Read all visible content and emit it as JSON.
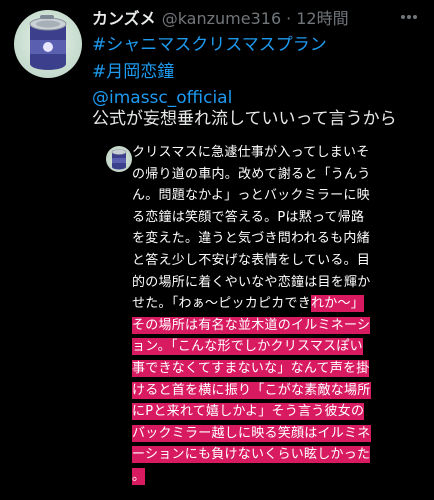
{
  "tweet": {
    "display_name": "カンズメ",
    "handle": "@kanzume316",
    "separator": "·",
    "timestamp": "12時間",
    "hashtags": [
      "#シャニマスクリスマスプラン",
      "#月岡恋鐘"
    ],
    "mention": "@imassc_official",
    "text": "公式が妄想垂れ流していいって言うから"
  },
  "memo": {
    "lines": [
      {
        "plain": "クリスマスに急遽仕事が入ってしまいそ",
        "highlight": ""
      },
      {
        "plain": "の帰り道の車内。改めて謝ると「うんう",
        "highlight": ""
      },
      {
        "plain": "ん。問題なかよ」っとバックミラーに映",
        "highlight": ""
      },
      {
        "plain": "る恋鐘は笑顔で答える。Pは黙って帰路",
        "highlight": ""
      },
      {
        "plain": "を変えた。違うと気づき問われるも内緒",
        "highlight": ""
      },
      {
        "plain": "と答え少し不安げな表情をしている。目",
        "highlight": ""
      },
      {
        "plain": "的の場所に着くやいなや恋鐘は目を輝か",
        "highlight": ""
      },
      {
        "plain": "せた。「わぁ〜ピッカピカでき",
        "highlight": "れか〜」"
      },
      {
        "plain": "",
        "highlight": "その場所は有名な並木道のイルミネーシ"
      },
      {
        "plain": "",
        "highlight": "ョン。「こんな形でしかクリスマスぽい"
      },
      {
        "plain": "",
        "highlight": "事できなくてすまないな」なんて声を掛"
      },
      {
        "plain": "",
        "highlight": "けると首を横に振り「こがな素敵な場所"
      },
      {
        "plain": "",
        "highlight": "にPと来れて嬉しかよ」そう言う彼女の"
      },
      {
        "plain": "",
        "highlight": "バックミラー越しに映る笑顔はイルミネ"
      },
      {
        "plain": "",
        "highlight": "ーションにも負けないくらい眩しかった"
      },
      {
        "plain": "",
        "highlight": "。"
      }
    ]
  },
  "colors": {
    "background": "#000000",
    "link": "#1d9bf0",
    "muted": "#71767b",
    "highlight": "#d81b60"
  },
  "icons": {
    "avatar": "canned-food-avatar",
    "more": "more-dots-icon"
  }
}
